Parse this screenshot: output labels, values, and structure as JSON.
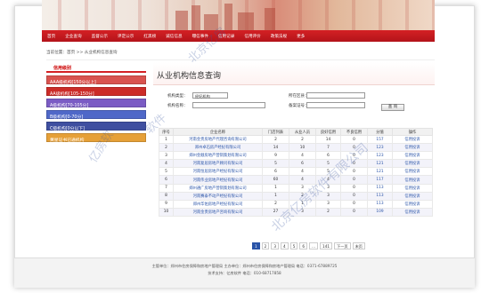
{
  "nav": [
    "首页",
    "企业查询",
    "监督公示",
    "评定公示",
    "红黑榜",
    "诚信信息",
    "曝信事件",
    "信用记录",
    "信用评价",
    "政策法规",
    "更多"
  ],
  "breadcrumb": "当前位置：首页 >> 从业机构信息查询",
  "sidebar": {
    "title": "信用级别",
    "items": [
      {
        "label": "AAA级机构[150分以上]",
        "color": "#d9534f"
      },
      {
        "label": "AA级机构[105-150分]",
        "color": "#cc2c28"
      },
      {
        "label": "A级机构[70-105分]",
        "color": "#7b5cc4"
      },
      {
        "label": "B级机构[0-70分]",
        "color": "#4f68c8"
      },
      {
        "label": "C级机构[0分以下]",
        "color": "#3f4fa0"
      },
      {
        "label": "黄星证书已通机构",
        "color": "#e6a038"
      }
    ]
  },
  "main": {
    "title": "从业机构信息查询",
    "form": {
      "type_label": "机构类型：",
      "type_value": "经纪机构",
      "region_label": "所在区县：",
      "region_value": "",
      "name_label": "机构名称：",
      "name_value": "",
      "cert_label": "备案证号：",
      "cert_value": "",
      "query_label": "查 询"
    }
  },
  "table": {
    "headers": [
      "序号",
      "企业名称",
      "门店列表",
      "从业人员",
      "良好信用",
      "不良信用",
      "分值",
      "操作"
    ],
    "rows": [
      {
        "no": "1",
        "name": "河南金贵房地产代理咨询有限公司",
        "stores": "2",
        "staff": "2",
        "good": "14",
        "bad": "0",
        "score": "157",
        "op": "信用投诉"
      },
      {
        "no": "2",
        "name": "郑州卓石房产经纪有限公司",
        "stores": "14",
        "staff": "10",
        "good": "7",
        "bad": "0",
        "score": "123",
        "op": "信用投诉"
      },
      {
        "no": "3",
        "name": "郑州金顺房地产营销策划有限公司",
        "stores": "9",
        "staff": "4",
        "good": "6",
        "bad": "0",
        "score": "123",
        "op": "信用投诉"
      },
      {
        "no": "4",
        "name": "河南复居房地产顾问有限公司",
        "stores": "5",
        "staff": "6",
        "good": "5",
        "bad": "0",
        "score": "121",
        "op": "信用投诉"
      },
      {
        "no": "5",
        "name": "河南恒居房地产经纪有限公司",
        "stores": "6",
        "staff": "4",
        "good": "5",
        "bad": "0",
        "score": "121",
        "op": "信用投诉"
      },
      {
        "no": "6",
        "name": "河南伟业房地产经纪有限公司",
        "stores": "60",
        "staff": "4",
        "good": "4",
        "bad": "0",
        "score": "117",
        "op": "信用投诉"
      },
      {
        "no": "7",
        "name": "郑州通广房地产营销策划有限公司",
        "stores": "1",
        "staff": "3",
        "good": "3",
        "bad": "0",
        "score": "113",
        "op": "信用投诉"
      },
      {
        "no": "8",
        "name": "河南赛泰不动产经纪有限公司",
        "stores": "1",
        "staff": "2",
        "good": "3",
        "bad": "0",
        "score": "113",
        "op": "信用投诉"
      },
      {
        "no": "9",
        "name": "郑州华佑房地产经纪有限公司",
        "stores": "2",
        "staff": "1",
        "good": "3",
        "bad": "0",
        "score": "113",
        "op": "信用投诉"
      },
      {
        "no": "10",
        "name": "河南金贵房地产咨询有限公司",
        "stores": "27",
        "staff": "3",
        "good": "2",
        "bad": "0",
        "score": "109",
        "op": "信用投诉"
      }
    ]
  },
  "pager": [
    "1",
    "2",
    "3",
    "4",
    "5",
    "6",
    "...",
    "141",
    "下一页",
    "末页"
  ],
  "footer": {
    "line1": "主管单位：郑州市住房保障和房地产管理局    主办单位：郑州市住房保障和房地产管理局    电话：0371-67889725",
    "line2": "技术支持：亿房软件  电话：010-68717858"
  },
  "watermark": [
    "北京亿房",
    "软件",
    "亿房软",
    "北京亿房软件有限公司"
  ],
  "colors": {
    "accent": "#d42024",
    "link": "#2a54a8"
  }
}
